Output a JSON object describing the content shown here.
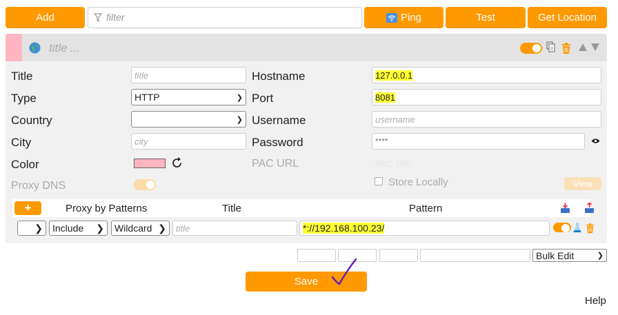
{
  "toolbar": {
    "add_label": "Add",
    "filter_placeholder": "filter",
    "ping_label": "Ping",
    "test_label": "Test",
    "get_location_label": "Get Location"
  },
  "proxy": {
    "title_placeholder": "title ...",
    "color_hex": "#ffb6c1",
    "fields": {
      "title_label": "Title",
      "title_placeholder": "title",
      "type_label": "Type",
      "type_value": "HTTP",
      "country_label": "Country",
      "country_value": "",
      "city_label": "City",
      "city_placeholder": "city",
      "color_label": "Color",
      "proxy_dns_label": "Proxy DNS",
      "hostname_label": "Hostname",
      "hostname_value": "127.0.0.1",
      "port_label": "Port",
      "port_value": "8081",
      "username_label": "Username",
      "username_placeholder": "username",
      "password_label": "Password",
      "password_value": "****",
      "pac_url_label": "PAC URL",
      "pac_url_placeholder": "PAC URL",
      "store_locally_label": "Store Locally",
      "view_label": "View"
    },
    "patterns": {
      "add_label": "+",
      "columns": [
        "Proxy by Patterns",
        "Title",
        "Pattern"
      ],
      "rows": [
        {
          "active_value": "",
          "include_value": "Include",
          "type_value": "Wildcard",
          "title_placeholder": "title",
          "pattern_value": "*://192.168.100.23/"
        }
      ]
    }
  },
  "bottom": {
    "bulk_edit_value": "Bulk Edit",
    "save_label": "Save",
    "help_label": "Help"
  },
  "colors": {
    "accent": "#ff9900",
    "highlight": "#ffff33"
  }
}
